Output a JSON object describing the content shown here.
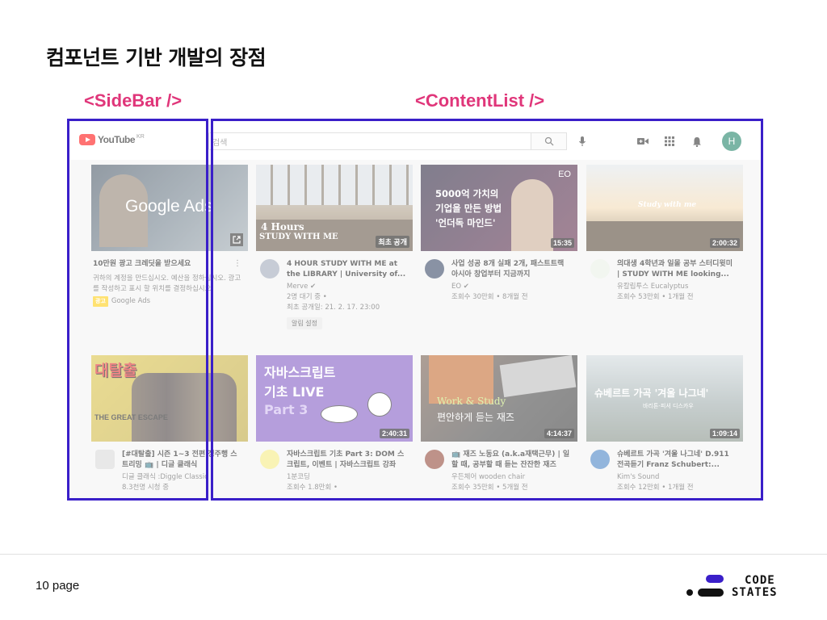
{
  "slide": {
    "title": "컴포넌트 기반 개발의 장점",
    "labels": {
      "sidebar": "<SideBar />",
      "content": "<ContentList />"
    },
    "page": "10 page",
    "logo": {
      "line1": "CODE",
      "line2": "STATES"
    }
  },
  "colors": {
    "label": "#e0367a",
    "outline": "#3a1fc9",
    "brand_red": "#ff0000",
    "avatar": "#0f7a5c",
    "logo_bar": "#3a1fc9"
  },
  "topbar": {
    "logo_text": "YouTube",
    "region": "KR",
    "search_placeholder": "검색",
    "icons": [
      "search-icon",
      "mic-icon",
      "video-camera-icon",
      "apps-grid-icon",
      "bell-icon"
    ],
    "avatar_letter": "H"
  },
  "videos": [
    {
      "title": "10만원 광고 크레딧을 받으세요",
      "desc": "귀하의 계정을 만드십시오. 예산을 정하십시오. 광고를 작성하고 표시 할 위치를 결정하십시오.",
      "badge": "광고",
      "channel": "Google Ads",
      "thumb_text": "Google Ads"
    },
    {
      "title": "4 HOUR STUDY WITH ME at the LIBRARY | University of...",
      "channel": "Merve",
      "stat1": "2명 대기 중 •",
      "stat2": "최초 공개일: 21. 2. 17. 23:00",
      "button": "알림 설정",
      "badge": "최초 공개",
      "thumb_text": "4 Hours",
      "thumb_text2": "STUDY WITH ME"
    },
    {
      "title": "사업 성공 8개 실패 2개, 패스트트랙 아시아 창업부터 지금까지",
      "channel": "EO",
      "stat1": "조회수 30만회 • 8개월 전",
      "duration": "15:35",
      "thumb_text": "5000억 가치의",
      "thumb_text2": "기업을 만든 방법",
      "thumb_text3": "'언더독 마인드'",
      "corner": "EO"
    },
    {
      "title": "의대생 4학년과 일몰 공부 스터디윗미 | STUDY WITH ME looking...",
      "channel": "유칼립투스 Eucalyptus",
      "stat1": "조회수 53만회 • 1개월 전",
      "duration": "2:00:32",
      "thumb_text": "Study with me"
    },
    {
      "title": "[#대탈출] 시즌 1~3 전편 정주행 스트리밍 📺 | 디글 클래식",
      "channel": "디글 클래식 :Diggle Classic",
      "stat1": "8.3천명 시청 중",
      "thumb_text": "대탈출",
      "thumb_text2": "THE GREAT ESCAPE"
    },
    {
      "title": "자바스크립트 기초 Part 3: DOM 스크립트, 이벤트 | 자바스크립트 강좌",
      "channel": "1분코딩",
      "stat1": "조회수 1.8만회 •",
      "duration": "2:40:31",
      "thumb_text": "자바스크립트",
      "thumb_text2": "기초 LIVE",
      "thumb_text3": "Part 3"
    },
    {
      "title": "📺 재즈 노동요 (a.k.a재택근무) | 일 할 때, 공부할 때 듣는 잔잔한 재즈",
      "channel": "우든체어 wooden chair",
      "stat1": "조회수 35만회 • 5개월 전",
      "duration": "4:14:37",
      "thumb_text": "Work & Study",
      "thumb_text2": "편안하게 듣는 재즈"
    },
    {
      "title": "슈베르트 가곡 '겨울 나그네' D.911 전곡듣기 Franz Schubert:...",
      "channel": "Kim's Sound",
      "stat1": "조회수 12만회 • 1개월 전",
      "duration": "1:09:14",
      "thumb_text": "슈베르트 가곡 '겨울 나그네'",
      "thumb_text2": "바리톤-피셔 디스카우"
    }
  ]
}
